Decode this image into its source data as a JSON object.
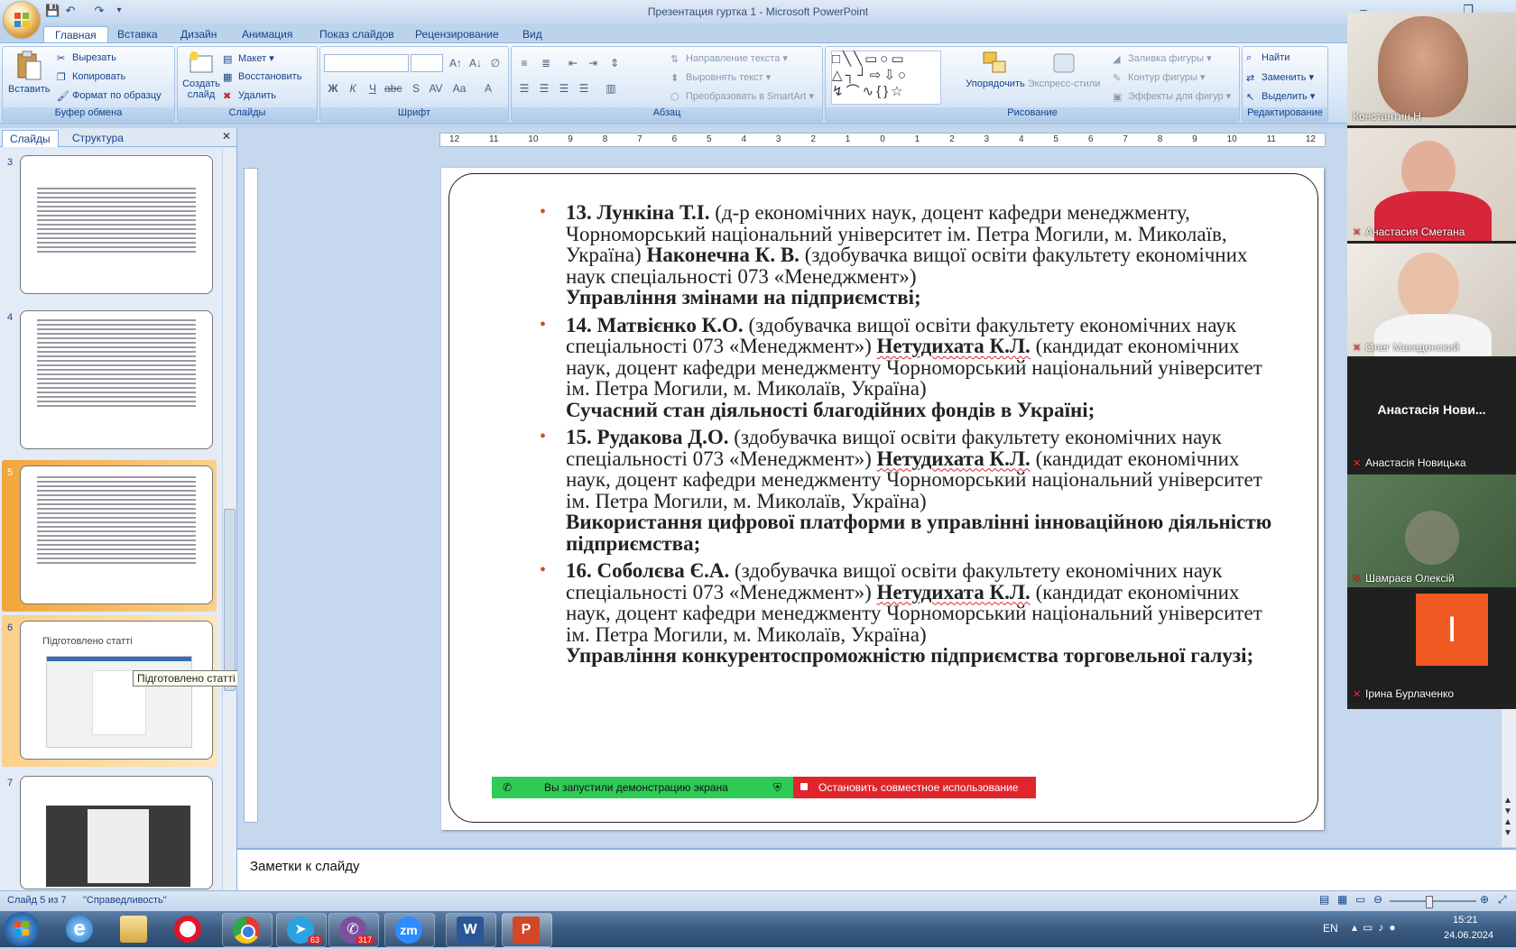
{
  "window": {
    "title": "Презентация гуртка 1 - Microsoft PowerPoint"
  },
  "tabs": [
    "Главная",
    "Вставка",
    "Дизайн",
    "Анимация",
    "Показ слайдов",
    "Рецензирование",
    "Вид"
  ],
  "ribbon": {
    "clipboard": {
      "label": "Буфер обмена",
      "paste": "Вставить",
      "cut": "Вырезать",
      "copy": "Копировать",
      "format_painter": "Формат по образцу"
    },
    "slides": {
      "label": "Слайды",
      "new_slide": "Создать слайд",
      "layout": "Макет",
      "reset": "Восстановить",
      "delete": "Удалить"
    },
    "font": {
      "label": "Шрифт"
    },
    "paragraph": {
      "label": "Абзац",
      "text_direction": "Направление текста",
      "align_text": "Выровнять текст",
      "smartart": "Преобразовать в SmartArt"
    },
    "drawing": {
      "label": "Рисование",
      "arrange": "Упорядочить",
      "quick_styles": "Экспресс-стили",
      "shape_fill": "Заливка фигуры",
      "shape_outline": "Контур фигуры",
      "shape_effects": "Эффекты для фигур"
    },
    "editing": {
      "label": "Редактирование",
      "find": "Найти",
      "replace": "Заменить",
      "select": "Выделить"
    }
  },
  "left_panel": {
    "tab_slides": "Слайды",
    "tab_outline": "Структура",
    "thumbs": [
      {
        "number": "3"
      },
      {
        "number": "4"
      },
      {
        "number": "5"
      },
      {
        "number": "6",
        "title": "Підготовлено статті"
      },
      {
        "number": "7"
      }
    ],
    "tooltip": "Підготовлено статті"
  },
  "ruler": {
    "h_ticks": [
      "12",
      "11",
      "10",
      "9",
      "8",
      "7",
      "6",
      "5",
      "4",
      "3",
      "2",
      "1",
      "0",
      "1",
      "2",
      "3",
      "4",
      "5",
      "6",
      "7",
      "8",
      "9",
      "10",
      "11",
      "12"
    ]
  },
  "slide": {
    "items": [
      {
        "num": "13. Лункіна Т.І.",
        "p1": " (д-р економічних наук, доцент кафедри менеджменту, Чорноморський національний університет ім. Петра Могили, м. Миколаїв, Україна)  ",
        "name2": "Наконечна К. В.",
        "p2": " (здобувачка вищої освіти факультету економічних наук спеціальності 073 «Менеджмент»)",
        "title": "Управління змінами на підприємстві;"
      },
      {
        "num": "14. Матвієнко К.О.",
        "p1": " (здобувачка вищої освіти факультету економічних наук спеціальності 073 «Менеджмент») ",
        "name2": "Нетудихата К.Л.",
        "p2": " (кандидат економічних наук, доцент кафедри менеджменту Чорноморський національний університет ім. Петра Могили, м. Миколаїв, Україна)",
        "title": "Сучасний стан діяльності благодійних фондів в Україні;"
      },
      {
        "num": "15. Рудакова Д.О.",
        "p1": " (здобувачка вищої освіти факультету економічних наук спеціальності 073 «Менеджмент») ",
        "name2": "Нетудихата К.Л.",
        "p2": " (кандидат економічних наук, доцент кафедри менеджменту Чорноморський національний університет ім. Петра Могили, м. Миколаїв, Україна)",
        "title": "Використання цифрової платформи в управлінні інноваційною діяльністю підприємства;"
      },
      {
        "num": "16. Соболєва Є.А.",
        "p1": " (здобувачка вищої освіти факультету економічних наук спеціальності 073 «Менеджмент») ",
        "name2": "Нетудихата К.Л.",
        "p2": " (кандидат економічних наук, доцент кафедри менеджменту Чорноморський національний університет ім. Петра Могили, м. Миколаїв, Україна)",
        "title": "Управління конкурентоспроможністю підприємства торговельної галузі;"
      }
    ]
  },
  "share_bar": {
    "status": "Вы запустили демонстрацию экрана",
    "stop": "Остановить совместное использование"
  },
  "notes": {
    "placeholder": "Заметки к слайду"
  },
  "status": {
    "slide_info": "Слайд 5 из 7",
    "theme": "\"Справедливость\""
  },
  "taskbar": {
    "lang": "EN",
    "time": "15:21",
    "date": "24.06.2024",
    "telegram_badge": "63",
    "viber_badge": "317",
    "zoom_label": "zm"
  },
  "participants": [
    {
      "name": "Константин Н",
      "muted": false
    },
    {
      "name": "Анастасия Сметана",
      "muted": true
    },
    {
      "name": "Олег Македонский",
      "muted": true
    },
    {
      "name": "Анастасія Новицька",
      "display": "Анастасія Нови...",
      "muted": true
    },
    {
      "name": "Шамраєв Олексій",
      "muted": true
    },
    {
      "name": "Ірина Бурлаченко",
      "avatar": "І",
      "muted": true
    }
  ],
  "colors": {
    "bullet": "#d24a26",
    "share_green": "#2ecb55",
    "share_red": "#e0252c",
    "avatar_orange": "#f05a22"
  }
}
